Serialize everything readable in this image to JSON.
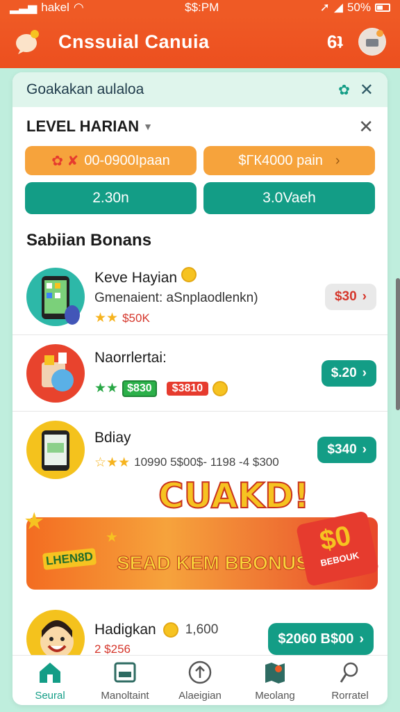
{
  "status": {
    "carrier": "hakel",
    "time": "$$:PM",
    "battery": "50%"
  },
  "header": {
    "app_title": "Cnssuial Canuia",
    "right_icon_text": "6ʇ"
  },
  "panel": {
    "title": "Goakakan aulaloa"
  },
  "level": {
    "title": "LEVEL HARIAN",
    "buttons": [
      {
        "label": "00-0900Ipaan"
      },
      {
        "label": "$ГК4000 pain"
      },
      {
        "label": "2.30n"
      },
      {
        "label": "3.0Vaeh"
      }
    ]
  },
  "bonus": {
    "section_title": "Sabiian Bonans",
    "items": [
      {
        "name": "Keve Hayian",
        "subtitle": "Gmenaient: aSnplaodlenkn)",
        "meta": "$50K",
        "price": "$30"
      },
      {
        "name": "Naorrlertai:",
        "meta_green": "$830",
        "meta_red": "$3810",
        "price": "$.20"
      },
      {
        "name": "Bdiay",
        "meta": "10990 5$00$- 1198 -4 $300",
        "price": "$340"
      }
    ]
  },
  "banner": {
    "title": "CUAKD!",
    "subtitle": "SEAD KEM BBONUS",
    "left_label": "LHEN8D",
    "tag_value": "$0",
    "tag_text": "BEBOUK"
  },
  "bottom_item": {
    "name": "Hadigkan",
    "coins": "1,600",
    "meta": "2 $256",
    "price": "$2060 B$00"
  },
  "nav": {
    "items": [
      {
        "label": "Seural"
      },
      {
        "label": "Manoltaint"
      },
      {
        "label": "Alaeigian"
      },
      {
        "label": "Meolang"
      },
      {
        "label": "Rorratel"
      }
    ]
  },
  "colors": {
    "brand_orange": "#ef5a25",
    "teal": "#139d86",
    "accent_orange": "#f6a33c"
  }
}
